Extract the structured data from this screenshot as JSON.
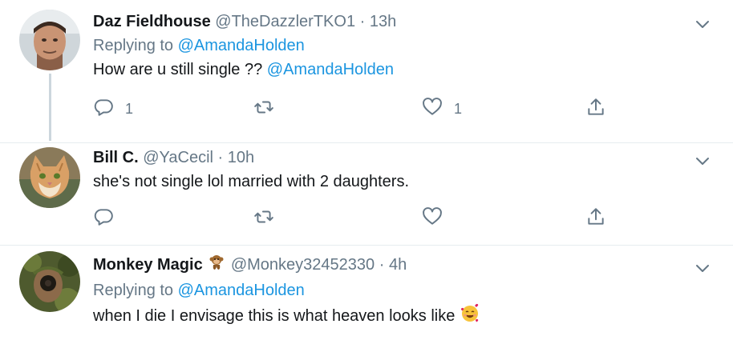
{
  "tweets": [
    {
      "name": "Daz Fieldhouse",
      "handle": "@TheDazzlerTKO1",
      "separator": "·",
      "time": "13h",
      "reply_prefix": "Replying to",
      "reply_to": "@AmandaHolden",
      "text": "How are u still single ??",
      "text_mention": "@AmandaHolden",
      "reply_count": "1",
      "retweet_count": "",
      "like_count": "1"
    },
    {
      "name": "Bill C.",
      "handle": "@YaCecil",
      "separator": "·",
      "time": "10h",
      "text": "she's not single lol married with 2 daughters.",
      "reply_count": "",
      "retweet_count": "",
      "like_count": ""
    },
    {
      "name": "Monkey Magic",
      "name_emoji": "monkey-emoji",
      "handle": "@Monkey32452330",
      "separator": "·",
      "time": "4h",
      "reply_prefix": "Replying to",
      "reply_to": "@AmandaHolden",
      "text": "when I die I envisage this is what heaven looks like",
      "text_emoji": "smiling-face-with-hearts-emoji"
    }
  ],
  "icons": {
    "reply": "reply-icon",
    "retweet": "retweet-icon",
    "like": "heart-icon",
    "share": "share-icon",
    "more": "chevron-down-icon"
  },
  "colors": {
    "link": "#1b95e0",
    "secondary": "#657786",
    "text": "#14171a",
    "thread_line": "#ccd6dd"
  }
}
